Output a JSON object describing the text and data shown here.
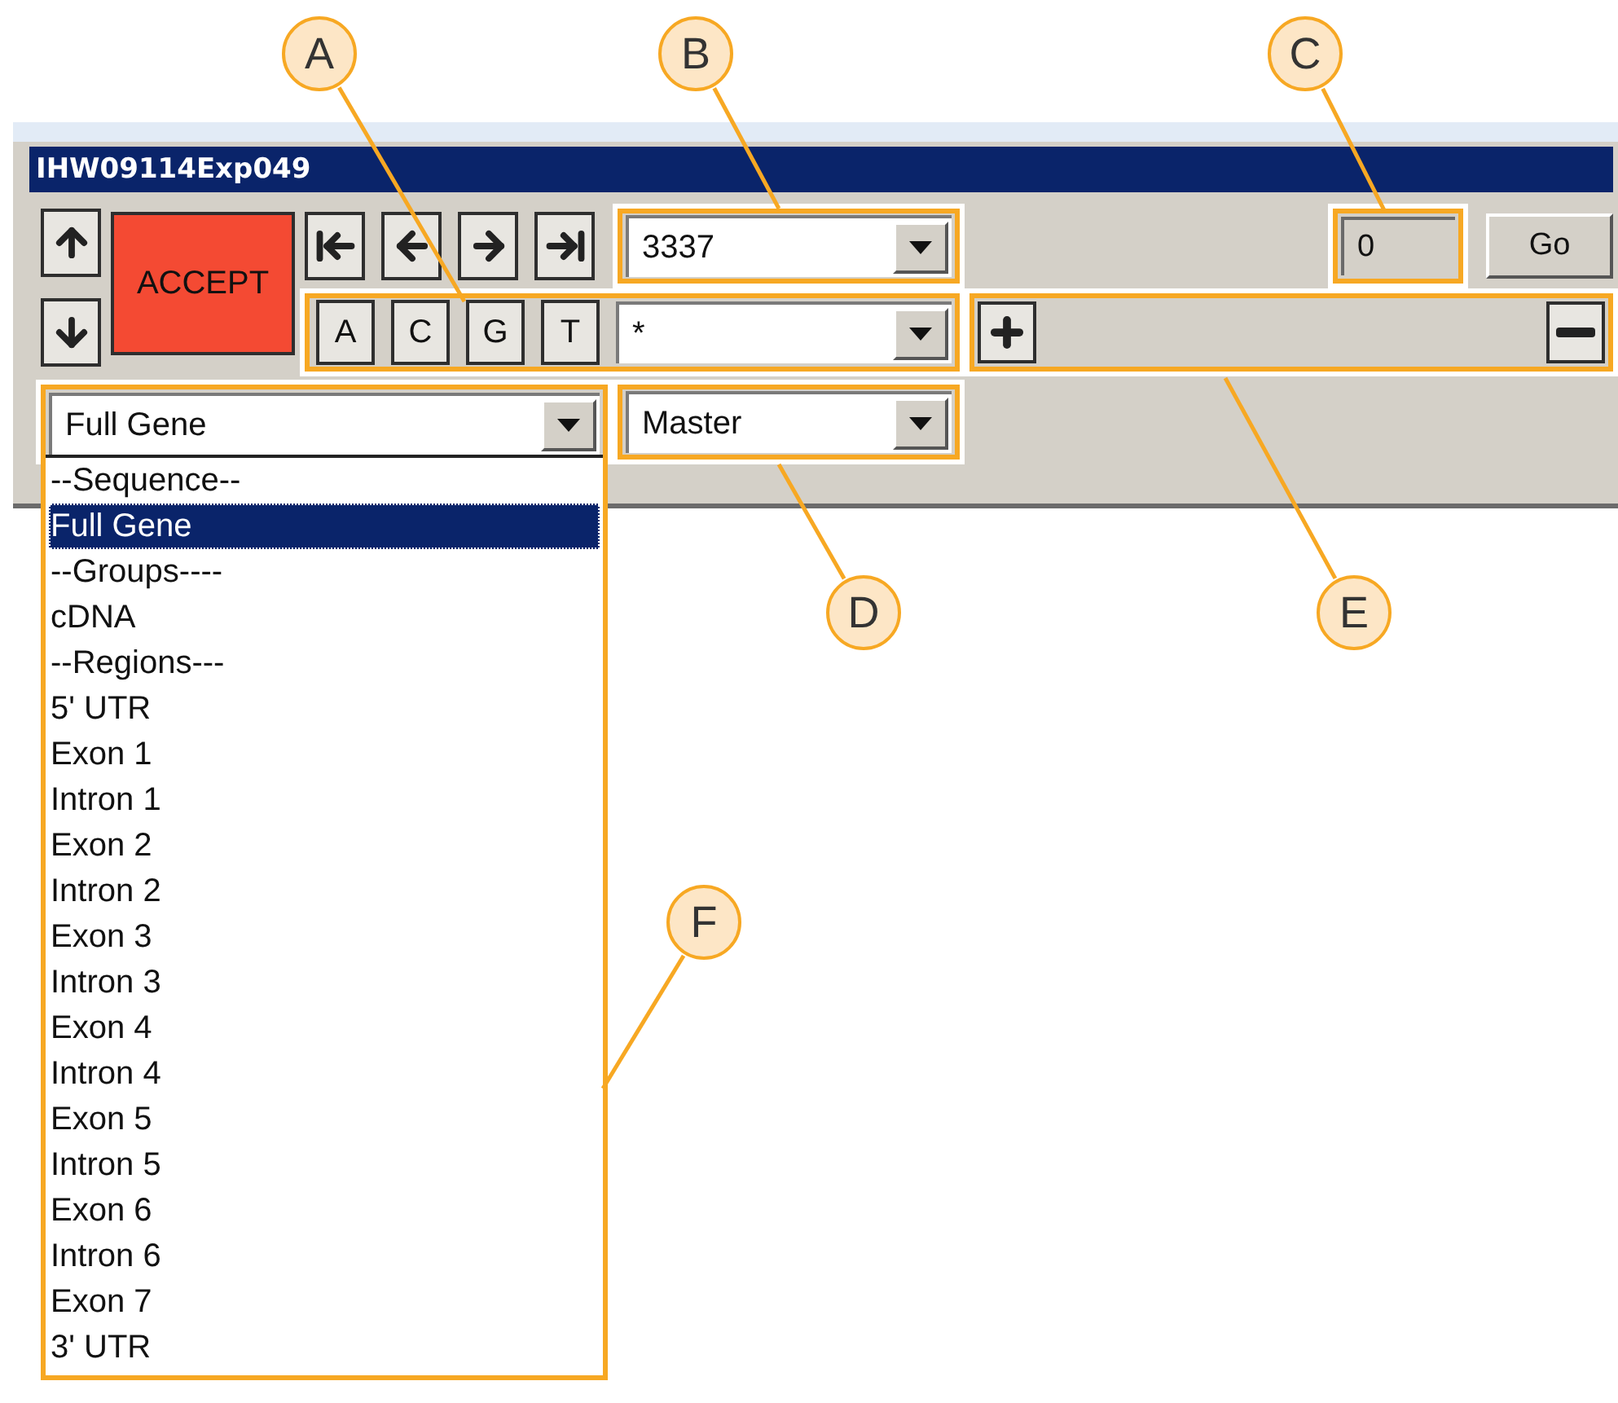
{
  "callouts": [
    {
      "letter": "A"
    },
    {
      "letter": "B"
    },
    {
      "letter": "C"
    },
    {
      "letter": "D"
    },
    {
      "letter": "E"
    },
    {
      "letter": "F"
    }
  ],
  "window": {
    "title": "IHW09114Exp049"
  },
  "accept_button": {
    "label": "ACCEPT"
  },
  "base_buttons": [
    "A",
    "C",
    "G",
    "T"
  ],
  "position_combo": {
    "value": "3337"
  },
  "filter_combo": {
    "value": "*"
  },
  "offset_field": {
    "value": "0"
  },
  "go_button": {
    "label": "Go"
  },
  "region_combo": {
    "value": "Full Gene",
    "expanded": true
  },
  "mode_combo": {
    "value": "Master"
  },
  "region_list": [
    {
      "label": "--Sequence--",
      "selected": false
    },
    {
      "label": "Full Gene",
      "selected": true
    },
    {
      "label": "--Groups----",
      "selected": false
    },
    {
      "label": "cDNA",
      "selected": false
    },
    {
      "label": "--Regions---",
      "selected": false
    },
    {
      "label": "5' UTR",
      "selected": false
    },
    {
      "label": "Exon 1",
      "selected": false
    },
    {
      "label": "Intron 1",
      "selected": false
    },
    {
      "label": "Exon 2",
      "selected": false
    },
    {
      "label": "Intron 2",
      "selected": false
    },
    {
      "label": "Exon 3",
      "selected": false
    },
    {
      "label": "Intron 3",
      "selected": false
    },
    {
      "label": "Exon 4",
      "selected": false
    },
    {
      "label": "Intron 4",
      "selected": false
    },
    {
      "label": "Exon 5",
      "selected": false
    },
    {
      "label": "Intron 5",
      "selected": false
    },
    {
      "label": "Exon 6",
      "selected": false
    },
    {
      "label": "Intron 6",
      "selected": false
    },
    {
      "label": "Exon 7",
      "selected": false
    },
    {
      "label": "3' UTR",
      "selected": false
    }
  ]
}
